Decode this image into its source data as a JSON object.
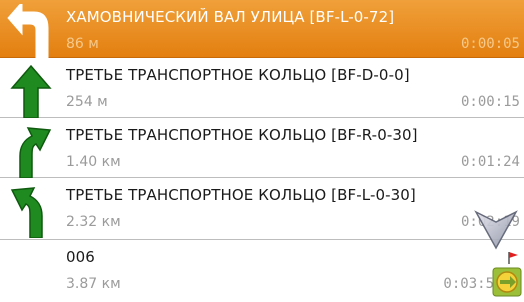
{
  "route_steps": [
    {
      "street": "ХАМОВНИЧЕСКИЙ ВАЛ УЛИЦА [BF-L-0-72]",
      "distance": "86 м",
      "time": "0:00:05",
      "maneuver": "sharp-left",
      "active": true
    },
    {
      "street": "ТРЕТЬЕ ТРАНСПОРТНОЕ КОЛЬЦО [BF-D-0-0]",
      "distance": "254 м",
      "time": "0:00:15",
      "maneuver": "straight",
      "active": false
    },
    {
      "street": "ТРЕТЬЕ ТРАНСПОРТНОЕ КОЛЬЦО [BF-R-0-30]",
      "distance": "1.40 км",
      "time": "0:01:24",
      "maneuver": "slight-right",
      "active": false
    },
    {
      "street": "ТРЕТЬЕ ТРАНСПОРТНОЕ КОЛЬЦО [BF-L-0-30]",
      "distance": "2.32 км",
      "time": "0:02:19",
      "maneuver": "slight-left",
      "active": false
    },
    {
      "street": "006",
      "distance": "3.87 км",
      "time": "0:03:5",
      "maneuver": "destination",
      "active": false
    }
  ],
  "colors": {
    "active_row": "#e8891a",
    "arrow_green": "#1f8a1f",
    "arrow_white": "#ffffff"
  },
  "icons": {
    "scroll_down": "chevron-down-icon",
    "destination_flag": "flag-icon",
    "go_button": "go-icon"
  }
}
